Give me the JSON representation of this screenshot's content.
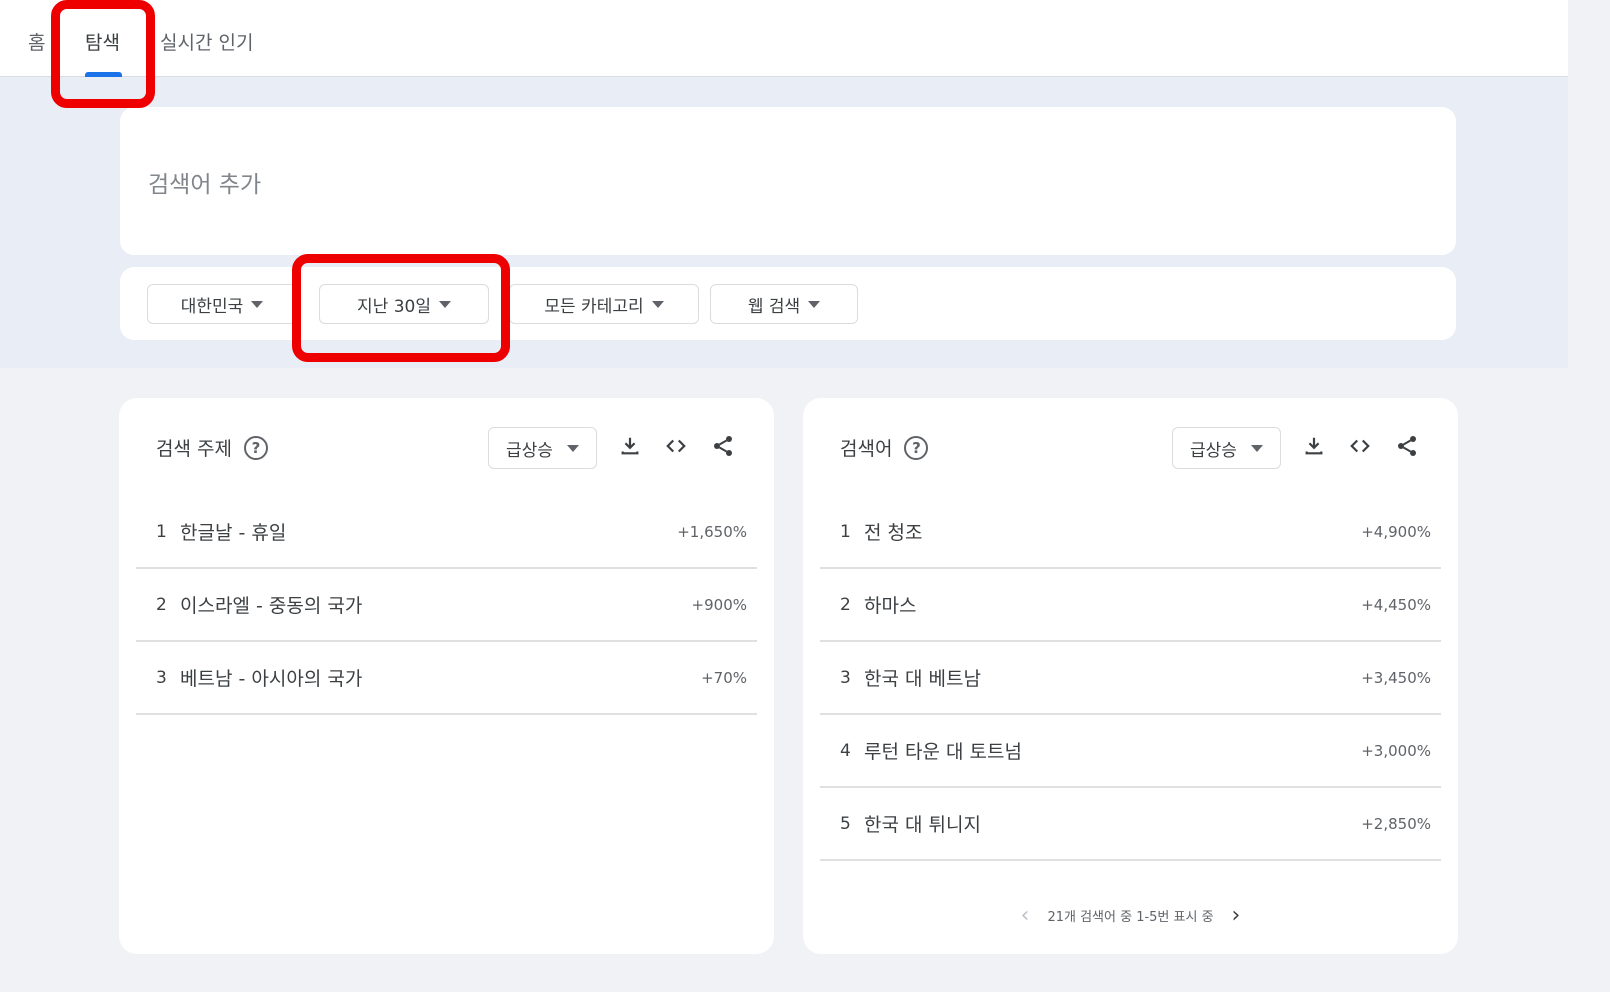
{
  "tabs": {
    "home": "홈",
    "explore": "탐색",
    "trending": "실시간 인기"
  },
  "search": {
    "placeholder": "검색어 추가"
  },
  "filters": {
    "region": "대한민국",
    "period": "지난 30일",
    "category": "모든 카테고리",
    "search_type": "웹 검색"
  },
  "topics_panel": {
    "title": "검색 주제",
    "sort": "급상승",
    "items": [
      {
        "index": "1",
        "label": "한글날 - 휴일",
        "value": "+1,650%"
      },
      {
        "index": "2",
        "label": "이스라엘 - 중동의 국가",
        "value": "+900%"
      },
      {
        "index": "3",
        "label": "베트남 - 아시아의 국가",
        "value": "+70%"
      }
    ]
  },
  "queries_panel": {
    "title": "검색어",
    "sort": "급상승",
    "items": [
      {
        "index": "1",
        "label": "전 청조",
        "value": "+4,900%"
      },
      {
        "index": "2",
        "label": "하마스",
        "value": "+4,450%"
      },
      {
        "index": "3",
        "label": "한국 대 베트남",
        "value": "+3,450%"
      },
      {
        "index": "4",
        "label": "루턴 타운 대 토트넘",
        "value": "+3,000%"
      },
      {
        "index": "5",
        "label": "한국 대 튀니지",
        "value": "+2,850%"
      }
    ],
    "pagination": "21개 검색어 중 1-5번 표시 중"
  },
  "colors": {
    "accent": "#1a73e8",
    "highlight": "#ee0000",
    "band": "#e8edf6"
  }
}
